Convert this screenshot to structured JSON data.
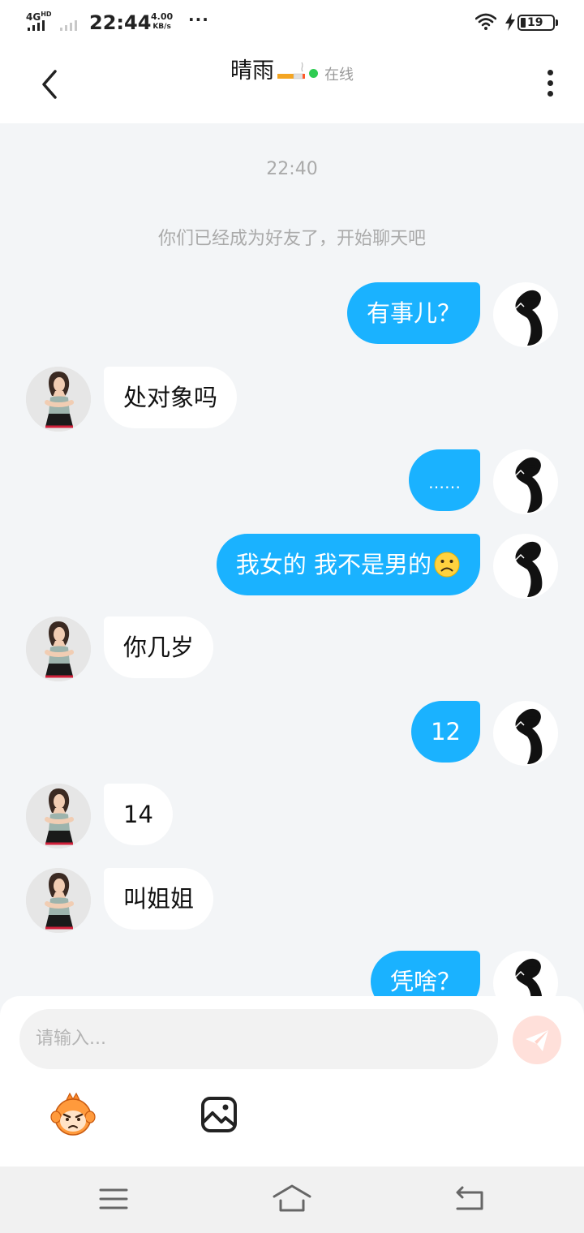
{
  "status_bar": {
    "network": "4G",
    "network_sup": "HD",
    "time": "22:44",
    "speed_value": "4.00",
    "speed_unit": "KB/s",
    "dots": "···",
    "battery_level": "19"
  },
  "header": {
    "contact_name": "晴雨",
    "status_text": "在线",
    "status_color": "#2ecc52"
  },
  "chat": {
    "timestamp": "22:40",
    "system_notice": "你们已经成为好友了，开始聊天吧",
    "messages": [
      {
        "direction": "out",
        "text": "有事儿？"
      },
      {
        "direction": "in",
        "text": "处对象吗"
      },
      {
        "direction": "out",
        "text": "……"
      },
      {
        "direction": "out",
        "text": "我女的 我不是男的"
      },
      {
        "direction": "in",
        "text": "你几岁"
      },
      {
        "direction": "out",
        "text": "12"
      },
      {
        "direction": "in",
        "text": "14"
      },
      {
        "direction": "in",
        "text": "叫姐姐"
      },
      {
        "direction": "out",
        "text": "凭啥？"
      }
    ]
  },
  "composer": {
    "placeholder": "请输入..."
  },
  "colors": {
    "outgoing_bubble": "#1ab2ff",
    "incoming_bubble": "#ffffff",
    "background": "#f3f5f7",
    "send_button": "#ffe0da"
  },
  "icons": {
    "back": "chevron-left-icon",
    "more": "more-vertical-icon",
    "send": "paper-plane-icon",
    "emoji": "emoji-mascot-icon",
    "image": "image-icon",
    "menu": "menu-icon",
    "home": "home-icon",
    "return": "back-arrow-icon"
  }
}
